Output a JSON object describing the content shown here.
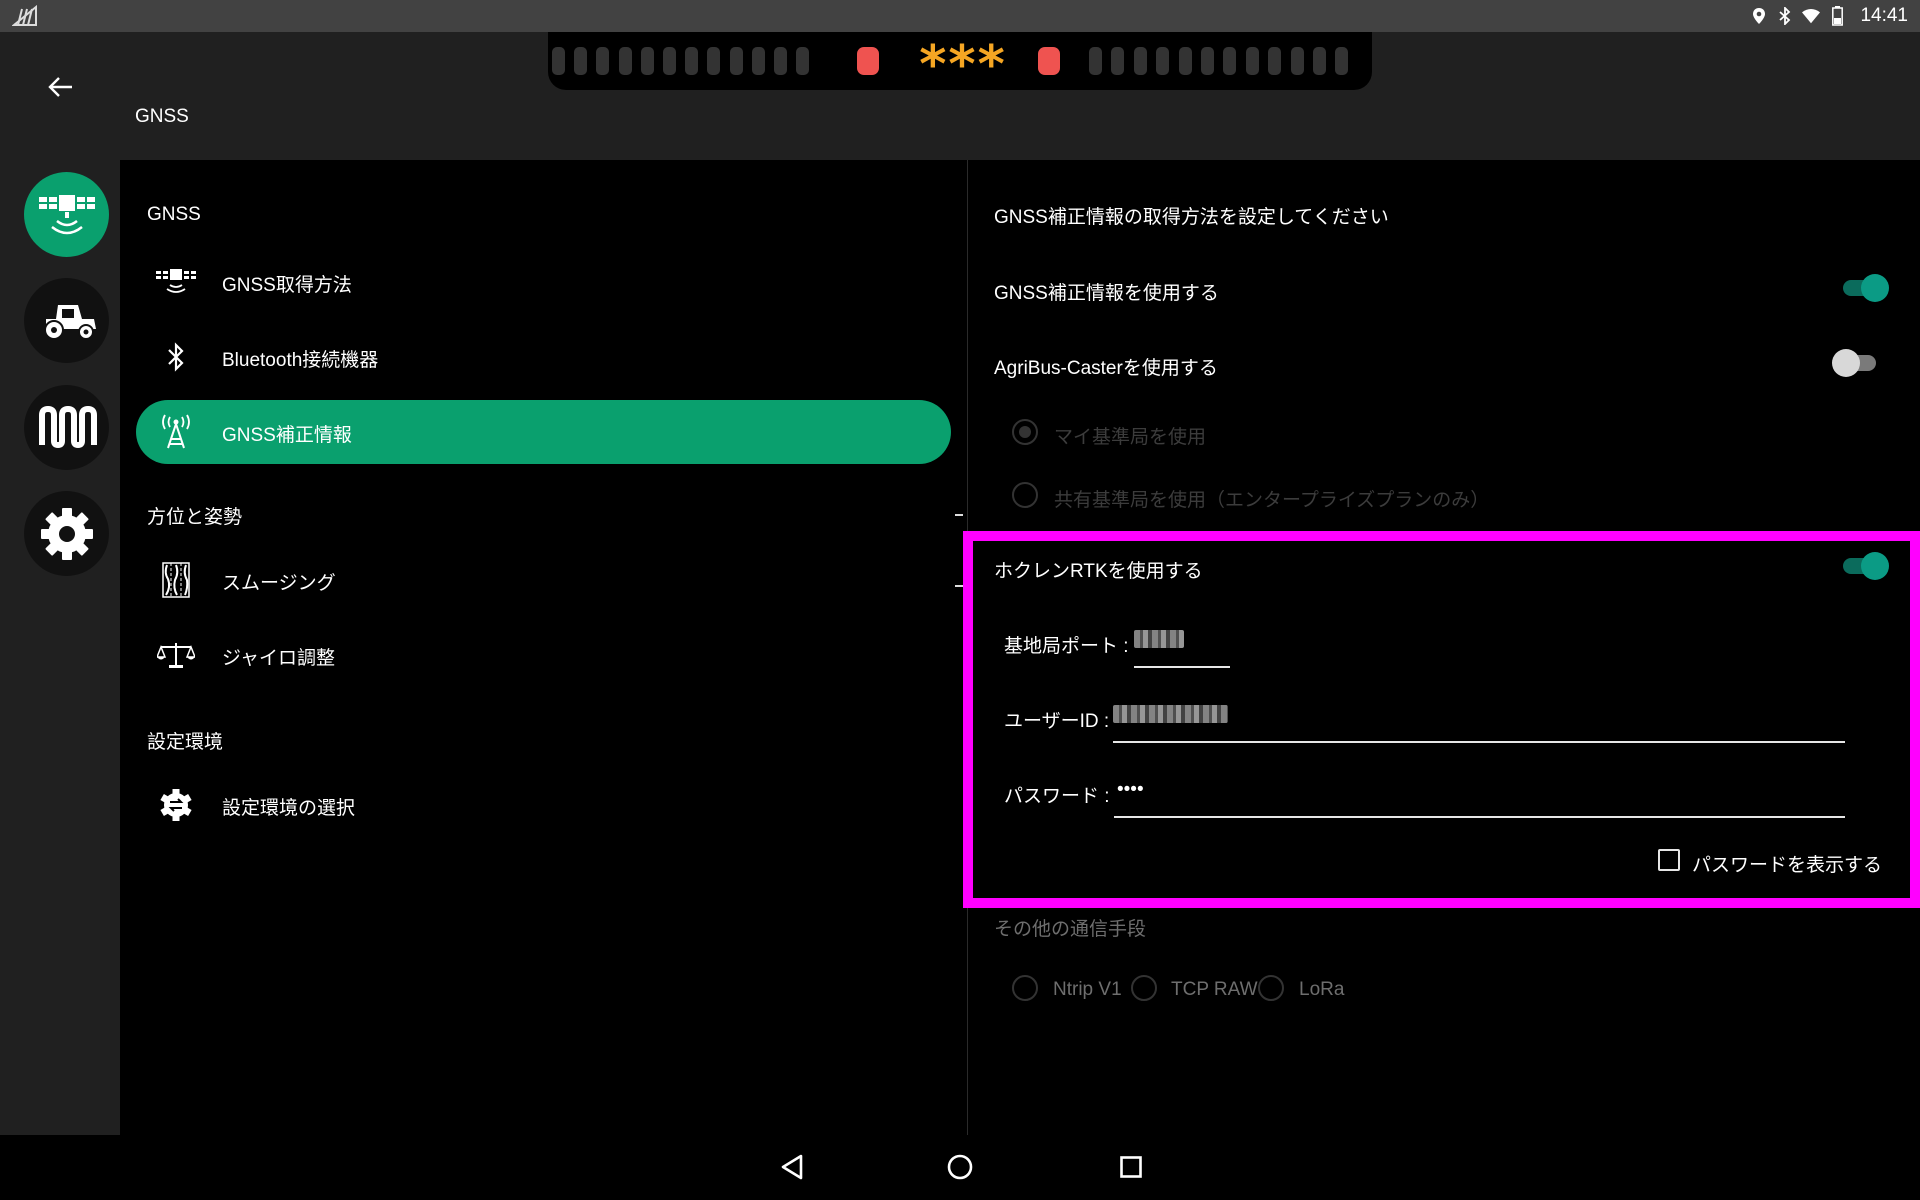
{
  "status_bar": {
    "time": "14:41",
    "icons": [
      "signal-off-icon",
      "location-icon",
      "bluetooth-icon",
      "wifi-icon",
      "battery-icon"
    ]
  },
  "app_bar": {
    "back_icon": "arrow-left-icon",
    "title": "GNSS"
  },
  "light_bar": {
    "center_text": "***",
    "accent_color": "#f5a623",
    "indicator_color": "#ef5350"
  },
  "rail": {
    "items": [
      {
        "icon": "satellite-icon",
        "active": true
      },
      {
        "icon": "tractor-icon",
        "active": false
      },
      {
        "icon": "implement-icon",
        "active": false
      },
      {
        "icon": "gear-icon",
        "active": false
      }
    ],
    "active_color": "#0aa06e"
  },
  "menu": {
    "sections": [
      {
        "title": "GNSS",
        "items": [
          {
            "label": "GNSS取得方法",
            "icon": "gnss-antenna-icon",
            "active": false
          },
          {
            "label": "Bluetooth接続機器",
            "icon": "bluetooth-icon",
            "active": false
          },
          {
            "label": "GNSS補正情報",
            "icon": "radio-tower-icon",
            "active": true
          }
        ]
      },
      {
        "title": "方位と姿勢",
        "items": [
          {
            "label": "スムージング",
            "icon": "smoothing-icon",
            "active": false
          },
          {
            "label": "ジャイロ調整",
            "icon": "balance-scale-icon",
            "active": false
          }
        ]
      },
      {
        "title": "設定環境",
        "items": [
          {
            "label": "設定環境の選択",
            "icon": "settings-sync-icon",
            "active": false
          }
        ]
      }
    ]
  },
  "panel": {
    "heading": "GNSS補正情報の取得方法を設定してください",
    "use_correction": {
      "label": "GNSS補正情報を使用する",
      "on": true
    },
    "agribus_caster": {
      "label": "AgriBus-Casterを使用する",
      "on": false
    },
    "caster_options": [
      {
        "label": "マイ基準局を使用",
        "selected": true
      },
      {
        "label": "共有基準局を使用（エンタープライズプランのみ）",
        "selected": false
      }
    ],
    "hokuren_rtk": {
      "label": "ホクレンRTKを使用する",
      "on": true,
      "port_label": "基地局ポート :",
      "user_label": "ユーザーID :",
      "password_label": "パスワード :",
      "password_value": "••••",
      "show_password": {
        "label": "パスワードを表示する",
        "checked": false
      }
    },
    "other_methods": {
      "label": "その他の通信手段",
      "options": [
        "Ntrip V1",
        "TCP RAW",
        "LoRa"
      ]
    },
    "highlight_color": "#ff00ff",
    "toggle_on_color": "#0b9b85"
  },
  "nav_bar": {
    "buttons": [
      "back-triangle-icon",
      "home-circle-icon",
      "recents-square-icon"
    ]
  }
}
